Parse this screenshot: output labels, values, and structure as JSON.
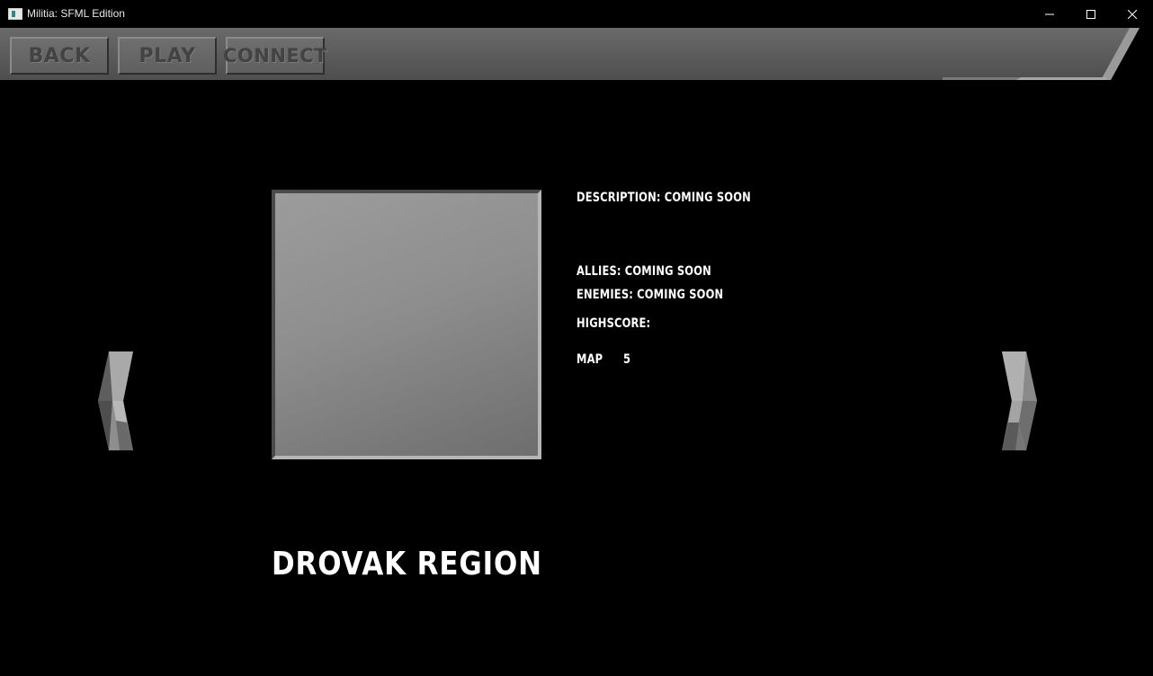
{
  "window": {
    "title": "Militia: SFML Edition",
    "controls": [
      "minimize",
      "maximize",
      "close"
    ]
  },
  "menu": {
    "back_label": "BACK",
    "play_label": "PLAY",
    "connect_label": "CONNECT"
  },
  "map": {
    "name": "DROVAK REGION",
    "description": "DESCRIPTION: COMING SOON",
    "allies": "ALLIES: COMING SOON",
    "enemies": "ENEMIES: COMING SOON",
    "highscore_label": "HIGHSCORE:",
    "map_label": "MAP",
    "map_number": "5"
  },
  "navigation": {
    "prev_icon": "chevron-left-icon",
    "next_icon": "chevron-right-icon"
  }
}
